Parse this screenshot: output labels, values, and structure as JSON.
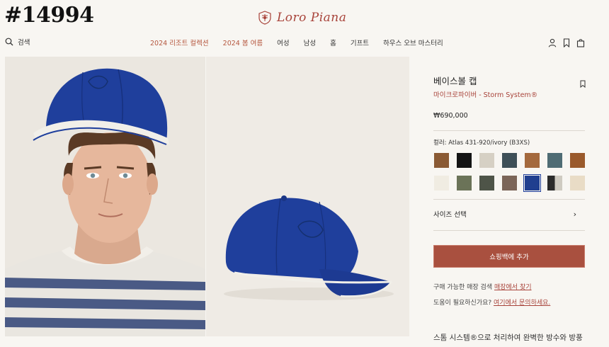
{
  "overlay_id": "#14994",
  "brand": {
    "name": "Loro Piana"
  },
  "search": {
    "label": "검색"
  },
  "nav": [
    {
      "label": "2024 리조트 컬렉션",
      "style": "accent"
    },
    {
      "label": "2024 봄 여름",
      "style": "accent"
    },
    {
      "label": "여성",
      "style": "plain"
    },
    {
      "label": "남성",
      "style": "plain"
    },
    {
      "label": "홈",
      "style": "plain"
    },
    {
      "label": "기프트",
      "style": "plain"
    },
    {
      "label": "하우스 오브 마스터리",
      "style": "plain"
    }
  ],
  "header_icons": [
    "user-icon",
    "bookmark-icon",
    "shopping-bag-icon"
  ],
  "product": {
    "title": "베이스볼 캡",
    "material": "마이크로파이버",
    "subtitle_sep": " - ",
    "system": "Storm System®",
    "price": "₩690,000",
    "color_label": "컬러: Atlas 431-920/ivory (B3XS)",
    "size_label": "사이즈 선택",
    "add_to_bag": "쇼핑백에 추가",
    "store_text": "구매 가능한 매장 검색 ",
    "store_link": "매장에서 찾기",
    "help_text": "도움이 필요하신가요? ",
    "help_link": "여기에서 문의하세요.",
    "description": "스톰 시스템®으로 처리하여 완벽한 방수와 방풍"
  },
  "swatches": [
    {
      "colors": [
        "#8a5a34"
      ],
      "selected": false
    },
    {
      "colors": [
        "#141414"
      ],
      "selected": false
    },
    {
      "colors": [
        "#d6d0c4"
      ],
      "selected": false
    },
    {
      "colors": [
        "#3e4f57"
      ],
      "selected": false
    },
    {
      "colors": [
        "#a4693d"
      ],
      "selected": false
    },
    {
      "colors": [
        "#4f6c74"
      ],
      "selected": false
    },
    {
      "colors": [
        "#9a5a2c"
      ],
      "selected": false
    },
    {
      "colors": [
        "#f0ece2"
      ],
      "selected": false
    },
    {
      "colors": [
        "#6b7358"
      ],
      "selected": false
    },
    {
      "colors": [
        "#4e5448"
      ],
      "selected": false
    },
    {
      "colors": [
        "#7b6558"
      ],
      "selected": false
    },
    {
      "colors": [
        "#203f8f"
      ],
      "selected": true
    },
    {
      "colors": [
        "#2b2b2b",
        "#cfcbc1"
      ],
      "selected": false
    },
    {
      "colors": [
        "#e9dcc6"
      ],
      "selected": false
    }
  ],
  "colors": {
    "accent": "#a8433a",
    "button": "#a9503f",
    "cap_blue": "#1f3f9c"
  }
}
